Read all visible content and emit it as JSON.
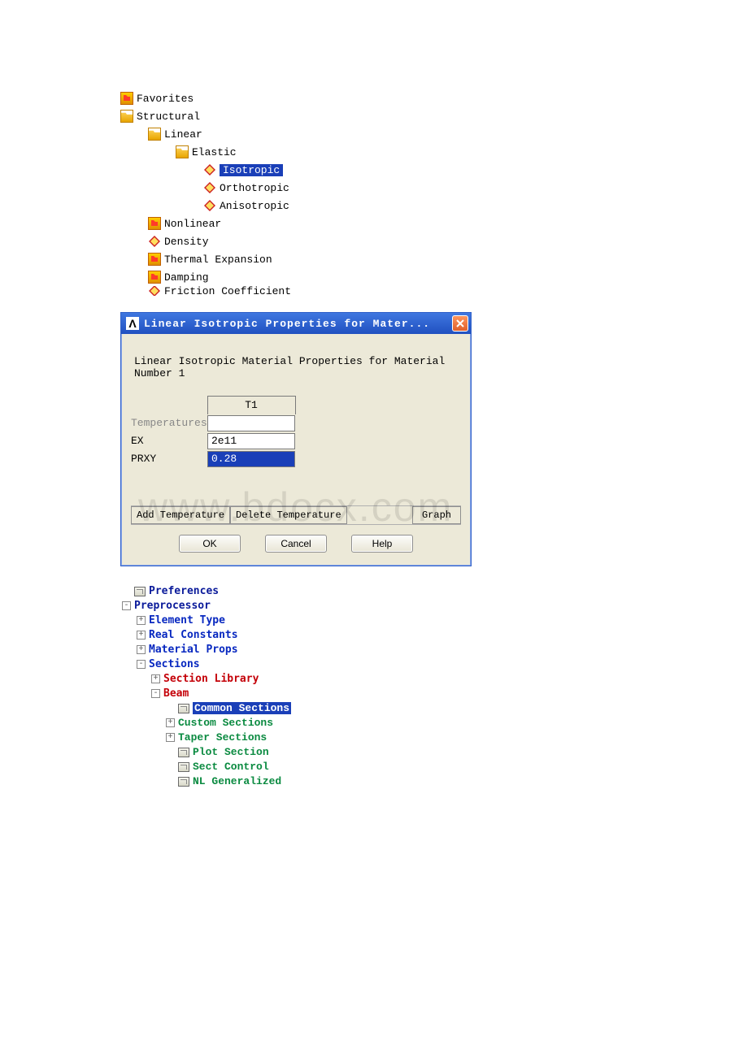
{
  "matTree": {
    "favorites": "Favorites",
    "structural": "Structural",
    "linear": "Linear",
    "elastic": "Elastic",
    "isotropic": "Isotropic",
    "orthotropic": "Orthotropic",
    "anisotropic": "Anisotropic",
    "nonlinear": "Nonlinear",
    "density": "Density",
    "thermal": "Thermal Expansion",
    "damping": "Damping",
    "friction": "Friction Coefficient"
  },
  "dialog": {
    "titleIconLetter": "Λ",
    "title": "Linear Isotropic Properties for Mater...",
    "desc": "Linear Isotropic Material Properties for Material Number 1",
    "colHeader": "T1",
    "rows": {
      "temperatures": "Temperatures",
      "ex": "EX",
      "prxy": "PRXY"
    },
    "values": {
      "temperatures": "",
      "ex": "2e11",
      "prxy": "0.28"
    },
    "btnAddTemp": "Add Temperature",
    "btnDelTemp": "Delete Temperature",
    "btnGraph": "Graph",
    "btnOK": "OK",
    "btnCancel": "Cancel",
    "btnHelp": "Help"
  },
  "menuTree": {
    "preferences": "Preferences",
    "preprocessor": "Preprocessor",
    "elemType": "Element Type",
    "realConst": "Real Constants",
    "matProps": "Material Props",
    "sections": "Sections",
    "sectLib": "Section Library",
    "beam": "Beam",
    "commonSect": "Common Sections",
    "customSect": "Custom Sections",
    "taperSect": "Taper Sections",
    "plotSect": "Plot Section",
    "sectCtrl": "Sect Control",
    "nlGen": "NL Generalized"
  },
  "watermark": "www.bdocx.com"
}
